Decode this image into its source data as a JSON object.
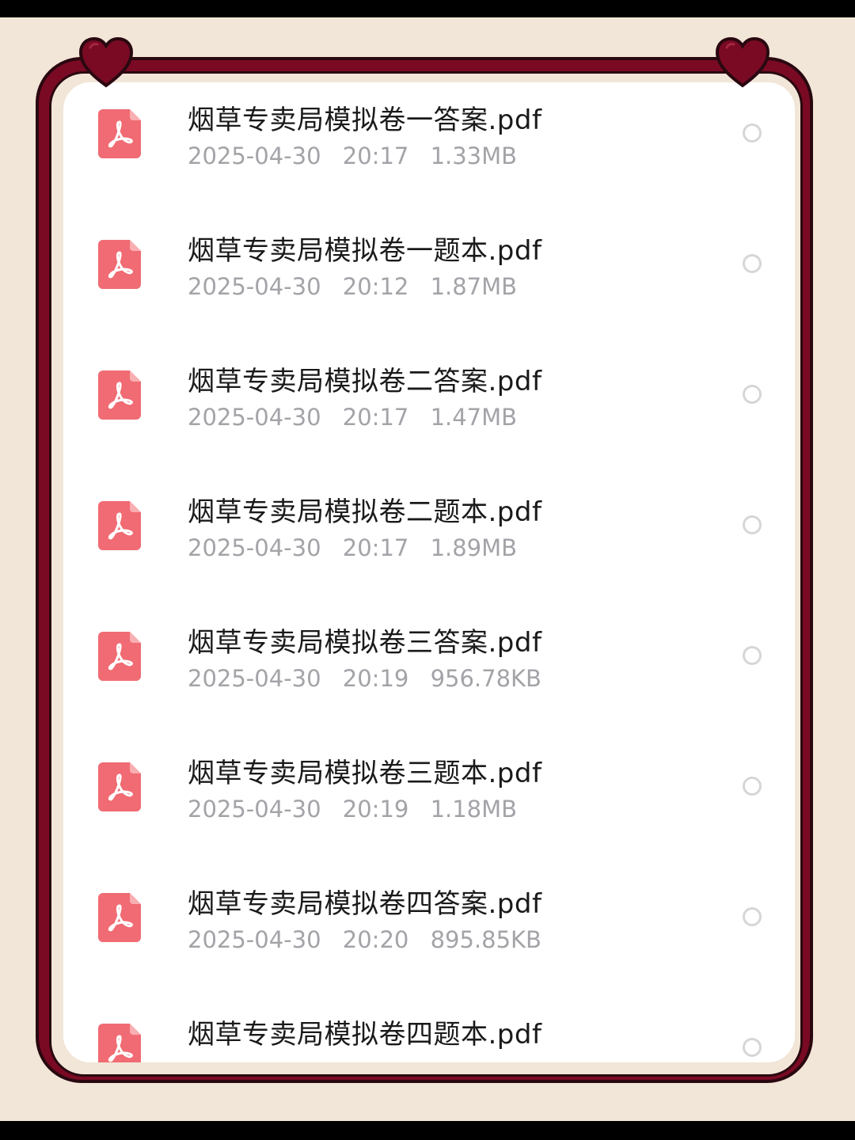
{
  "files": [
    {
      "name": "烟草专卖局模拟卷一答案.pdf",
      "date": "2025-04-30",
      "time": "20:17",
      "size": "1.33MB",
      "icon": "pdf-icon"
    },
    {
      "name": "烟草专卖局模拟卷一题本.pdf",
      "date": "2025-04-30",
      "time": "20:12",
      "size": "1.87MB",
      "icon": "pdf-icon"
    },
    {
      "name": "烟草专卖局模拟卷二答案.pdf",
      "date": "2025-04-30",
      "time": "20:17",
      "size": "1.47MB",
      "icon": "pdf-icon"
    },
    {
      "name": "烟草专卖局模拟卷二题本.pdf",
      "date": "2025-04-30",
      "time": "20:17",
      "size": "1.89MB",
      "icon": "pdf-icon"
    },
    {
      "name": "烟草专卖局模拟卷三答案.pdf",
      "date": "2025-04-30",
      "time": "20:19",
      "size": "956.78KB",
      "icon": "pdf-icon"
    },
    {
      "name": "烟草专卖局模拟卷三题本.pdf",
      "date": "2025-04-30",
      "time": "20:19",
      "size": "1.18MB",
      "icon": "pdf-icon"
    },
    {
      "name": "烟草专卖局模拟卷四答案.pdf",
      "date": "2025-04-30",
      "time": "20:20",
      "size": "895.85KB",
      "icon": "pdf-icon"
    },
    {
      "name": "烟草专卖局模拟卷四题本.pdf",
      "date": "",
      "time": "",
      "size": "",
      "icon": "pdf-icon"
    }
  ],
  "colors": {
    "background": "#f1e6d7",
    "frame": "#7a0a24",
    "pdf_icon": "#f06b73",
    "meta_text": "#a3a3a8"
  }
}
